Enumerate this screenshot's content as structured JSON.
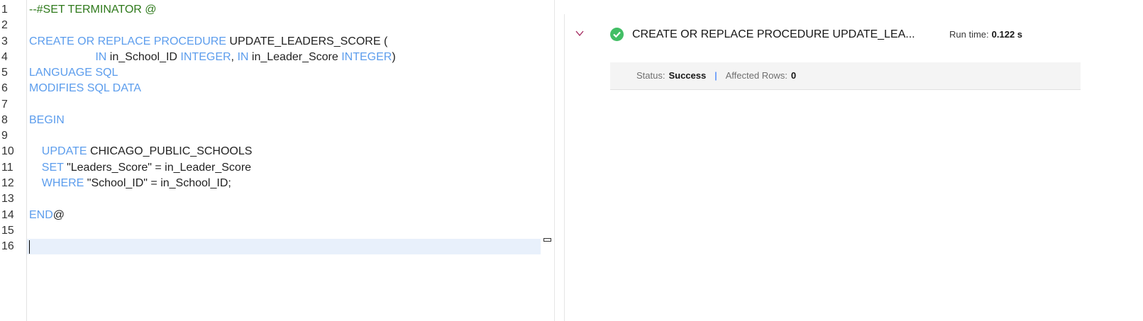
{
  "editor": {
    "lines": [
      [
        {
          "t": "--#SET TERMINATOR @",
          "k": "cm"
        }
      ],
      [],
      [
        {
          "t": "CREATE OR REPLACE PROCEDURE ",
          "k": "kw"
        },
        {
          "t": "UPDATE_LEADERS_SCORE (",
          "k": "id"
        }
      ],
      [
        {
          "t": "                     IN ",
          "k": "kw"
        },
        {
          "t": "in_School_ID ",
          "k": "id"
        },
        {
          "t": "INTEGER",
          "k": "kw"
        },
        {
          "t": ", ",
          "k": "id"
        },
        {
          "t": "IN ",
          "k": "kw"
        },
        {
          "t": "in_Leader_Score ",
          "k": "id"
        },
        {
          "t": "INTEGER",
          "k": "kw"
        },
        {
          "t": ")",
          "k": "id"
        }
      ],
      [
        {
          "t": "LANGUAGE SQL",
          "k": "kw"
        }
      ],
      [
        {
          "t": "MODIFIES SQL DATA",
          "k": "kw"
        }
      ],
      [],
      [
        {
          "t": "BEGIN",
          "k": "kw"
        }
      ],
      [],
      [
        {
          "t": "    UPDATE ",
          "k": "kw"
        },
        {
          "t": "CHICAGO_PUBLIC_SCHOOLS",
          "k": "id"
        }
      ],
      [
        {
          "t": "    SET ",
          "k": "kw"
        },
        {
          "t": "\"Leaders_Score\" = in_Leader_Score",
          "k": "id"
        }
      ],
      [
        {
          "t": "    WHERE ",
          "k": "kw"
        },
        {
          "t": "\"School_ID\" = in_School_ID;",
          "k": "id"
        }
      ],
      [],
      [
        {
          "t": "END",
          "k": "kw"
        },
        {
          "t": "@",
          "k": "id"
        }
      ],
      [],
      []
    ],
    "current_line": 16
  },
  "result": {
    "query": "CREATE OR REPLACE PROCEDURE UPDATE_LEA...",
    "run_time_label": "Run time:",
    "run_time": "0.122 s",
    "status_label": "Status:",
    "status": "Success",
    "separator": "|",
    "affected_label": "Affected Rows:",
    "affected": "0",
    "status_color": "#42be65"
  }
}
